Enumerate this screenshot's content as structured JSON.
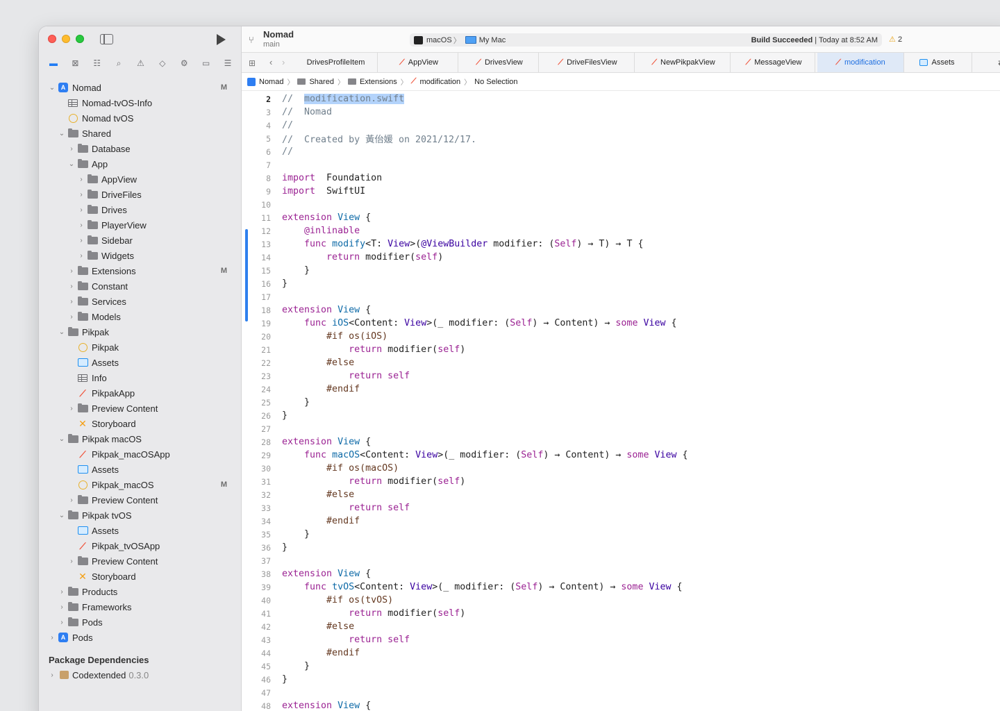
{
  "toolbar": {
    "project": "Nomad",
    "branch": "main",
    "scheme_platform": "macOS",
    "scheme_device": "My Mac",
    "build_status_bold": "Build Succeeded",
    "build_status_time": "| Today at 8:52 AM",
    "warning_count": "2"
  },
  "tabs": [
    {
      "label": "DrivesProfileItem",
      "type": "plain"
    },
    {
      "label": "AppView",
      "type": "swift"
    },
    {
      "label": "DrivesView",
      "type": "swift"
    },
    {
      "label": "DriveFilesView",
      "type": "swift"
    },
    {
      "label": "NewPikpakView",
      "type": "swift"
    },
    {
      "label": "MessageView",
      "type": "swift"
    },
    {
      "label": "modification",
      "type": "swift",
      "active": true
    },
    {
      "label": "Assets",
      "type": "assets"
    }
  ],
  "jumpbar": [
    "Nomad",
    "Shared",
    "Extensions",
    "modification",
    "No Selection"
  ],
  "tree": [
    {
      "label": "Nomad",
      "icon": "project",
      "depth": 0,
      "chev": "down",
      "badge": "M"
    },
    {
      "label": "Nomad-tvOS-Info",
      "icon": "table",
      "depth": 1
    },
    {
      "label": "Nomad tvOS",
      "icon": "target",
      "depth": 1
    },
    {
      "label": "Shared",
      "icon": "folder",
      "depth": 1,
      "chev": "down"
    },
    {
      "label": "Database",
      "icon": "folder",
      "depth": 2,
      "chev": "right"
    },
    {
      "label": "App",
      "icon": "folder",
      "depth": 2,
      "chev": "down"
    },
    {
      "label": "AppView",
      "icon": "folder",
      "depth": 3,
      "chev": "right"
    },
    {
      "label": "DriveFiles",
      "icon": "folder",
      "depth": 3,
      "chev": "right"
    },
    {
      "label": "Drives",
      "icon": "folder",
      "depth": 3,
      "chev": "right"
    },
    {
      "label": "PlayerView",
      "icon": "folder",
      "depth": 3,
      "chev": "right"
    },
    {
      "label": "Sidebar",
      "icon": "folder",
      "depth": 3,
      "chev": "right"
    },
    {
      "label": "Widgets",
      "icon": "folder",
      "depth": 3,
      "chev": "right"
    },
    {
      "label": "Extensions",
      "icon": "folder",
      "depth": 2,
      "chev": "right",
      "badge": "M"
    },
    {
      "label": "Constant",
      "icon": "folder",
      "depth": 2,
      "chev": "right"
    },
    {
      "label": "Services",
      "icon": "folder",
      "depth": 2,
      "chev": "right"
    },
    {
      "label": "Models",
      "icon": "folder",
      "depth": 2,
      "chev": "right"
    },
    {
      "label": "Pikpak",
      "icon": "folder",
      "depth": 1,
      "chev": "down"
    },
    {
      "label": "Pikpak",
      "icon": "target",
      "depth": 2
    },
    {
      "label": "Assets",
      "icon": "assets",
      "depth": 2
    },
    {
      "label": "Info",
      "icon": "table",
      "depth": 2
    },
    {
      "label": "PikpakApp",
      "icon": "swift",
      "depth": 2
    },
    {
      "label": "Preview Content",
      "icon": "folder",
      "depth": 2,
      "chev": "right"
    },
    {
      "label": "Storyboard",
      "icon": "xib",
      "depth": 2
    },
    {
      "label": "Pikpak macOS",
      "icon": "folder",
      "depth": 1,
      "chev": "down"
    },
    {
      "label": "Pikpak_macOSApp",
      "icon": "swift",
      "depth": 2
    },
    {
      "label": "Assets",
      "icon": "assets",
      "depth": 2
    },
    {
      "label": "Pikpak_macOS",
      "icon": "target",
      "depth": 2,
      "badge": "M"
    },
    {
      "label": "Preview Content",
      "icon": "folder",
      "depth": 2,
      "chev": "right"
    },
    {
      "label": "Pikpak tvOS",
      "icon": "folder",
      "depth": 1,
      "chev": "down"
    },
    {
      "label": "Assets",
      "icon": "assets",
      "depth": 2
    },
    {
      "label": "Pikpak_tvOSApp",
      "icon": "swift",
      "depth": 2
    },
    {
      "label": "Preview Content",
      "icon": "folder",
      "depth": 2,
      "chev": "right"
    },
    {
      "label": "Storyboard",
      "icon": "xib",
      "depth": 2
    },
    {
      "label": "Products",
      "icon": "folder",
      "depth": 1,
      "chev": "right"
    },
    {
      "label": "Frameworks",
      "icon": "folder",
      "depth": 1,
      "chev": "right"
    },
    {
      "label": "Pods",
      "icon": "folder",
      "depth": 1,
      "chev": "right"
    },
    {
      "label": "Pods",
      "icon": "project",
      "depth": 0,
      "chev": "right"
    }
  ],
  "package_dependencies": {
    "title": "Package Dependencies",
    "items": [
      {
        "name": "Codextended",
        "version": "0.3.0"
      }
    ]
  },
  "nav_icons": [
    "folder-icon",
    "source-control-icon",
    "symbol-icon",
    "find-icon",
    "issue-icon",
    "test-icon",
    "debug-icon",
    "breakpoint-icon",
    "report-icon"
  ],
  "code": [
    {
      "n": 2,
      "cur": true,
      "tokens": [
        [
          "c",
          "//  "
        ],
        [
          "sel c",
          "modification.swift"
        ]
      ]
    },
    {
      "n": 3,
      "tokens": [
        [
          "c",
          "//  Nomad"
        ]
      ]
    },
    {
      "n": 4,
      "tokens": [
        [
          "c",
          "//"
        ]
      ]
    },
    {
      "n": 5,
      "tokens": [
        [
          "c",
          "//  Created by 黃佁媛 on 2021/12/17."
        ]
      ]
    },
    {
      "n": 6,
      "tokens": [
        [
          "c",
          "//"
        ]
      ]
    },
    {
      "n": 7,
      "tokens": []
    },
    {
      "n": 8,
      "tokens": [
        [
          "k",
          "import"
        ],
        [
          "",
          "  Foundation"
        ]
      ]
    },
    {
      "n": 9,
      "tokens": [
        [
          "k",
          "import"
        ],
        [
          "",
          "  SwiftUI"
        ]
      ]
    },
    {
      "n": 10,
      "tokens": []
    },
    {
      "n": 11,
      "tokens": [
        [
          "k",
          "extension"
        ],
        [
          "",
          " "
        ],
        [
          "n",
          "View"
        ],
        [
          "",
          " {"
        ]
      ]
    },
    {
      "n": 12,
      "tokens": [
        [
          "",
          "    "
        ],
        [
          "k",
          "@inlinable"
        ]
      ]
    },
    {
      "n": 13,
      "tokens": [
        [
          "",
          "    "
        ],
        [
          "k",
          "func"
        ],
        [
          "",
          " "
        ],
        [
          "n",
          "modify"
        ],
        [
          "",
          "<T: "
        ],
        [
          "t",
          "View"
        ],
        [
          "",
          ">("
        ],
        [
          "t",
          "@ViewBuilder"
        ],
        [
          "",
          " modifier: ("
        ],
        [
          "k",
          "Self"
        ],
        [
          "",
          ") → T) → T {"
        ]
      ]
    },
    {
      "n": 14,
      "tokens": [
        [
          "",
          "        "
        ],
        [
          "k",
          "return"
        ],
        [
          "",
          " modifier("
        ],
        [
          "k",
          "self"
        ],
        [
          "",
          ")"
        ]
      ]
    },
    {
      "n": 15,
      "tokens": [
        [
          "",
          "    }"
        ]
      ]
    },
    {
      "n": 16,
      "tokens": [
        [
          "",
          "}"
        ]
      ]
    },
    {
      "n": 17,
      "tokens": []
    },
    {
      "n": 18,
      "tokens": [
        [
          "k",
          "extension"
        ],
        [
          "",
          " "
        ],
        [
          "n",
          "View"
        ],
        [
          "",
          " {"
        ]
      ]
    },
    {
      "n": 19,
      "tokens": [
        [
          "",
          "    "
        ],
        [
          "k",
          "func"
        ],
        [
          "",
          " "
        ],
        [
          "n",
          "iOS"
        ],
        [
          "",
          "<Content: "
        ],
        [
          "t",
          "View"
        ],
        [
          "",
          ">(_ modifier: ("
        ],
        [
          "k",
          "Self"
        ],
        [
          "",
          ") → Content) → "
        ],
        [
          "k",
          "some"
        ],
        [
          "",
          " "
        ],
        [
          "t",
          "View"
        ],
        [
          "",
          " {"
        ]
      ]
    },
    {
      "n": 20,
      "tokens": [
        [
          "",
          "        "
        ],
        [
          "p",
          "#if os(iOS)"
        ]
      ]
    },
    {
      "n": 21,
      "tokens": [
        [
          "",
          "            "
        ],
        [
          "k",
          "return"
        ],
        [
          "",
          " modifier("
        ],
        [
          "k",
          "self"
        ],
        [
          "",
          ")"
        ]
      ]
    },
    {
      "n": 22,
      "tokens": [
        [
          "",
          "        "
        ],
        [
          "p",
          "#else"
        ]
      ]
    },
    {
      "n": 23,
      "tokens": [
        [
          "",
          "            "
        ],
        [
          "k",
          "return"
        ],
        [
          "",
          " "
        ],
        [
          "k",
          "self"
        ]
      ]
    },
    {
      "n": 24,
      "tokens": [
        [
          "",
          "        "
        ],
        [
          "p",
          "#endif"
        ]
      ]
    },
    {
      "n": 25,
      "tokens": [
        [
          "",
          "    }"
        ]
      ]
    },
    {
      "n": 26,
      "tokens": [
        [
          "",
          "}"
        ]
      ]
    },
    {
      "n": 27,
      "tokens": []
    },
    {
      "n": 28,
      "tokens": [
        [
          "k",
          "extension"
        ],
        [
          "",
          " "
        ],
        [
          "n",
          "View"
        ],
        [
          "",
          " {"
        ]
      ]
    },
    {
      "n": 29,
      "tokens": [
        [
          "",
          "    "
        ],
        [
          "k",
          "func"
        ],
        [
          "",
          " "
        ],
        [
          "n",
          "macOS"
        ],
        [
          "",
          "<Content: "
        ],
        [
          "t",
          "View"
        ],
        [
          "",
          ">(_ modifier: ("
        ],
        [
          "k",
          "Self"
        ],
        [
          "",
          ") → Content) → "
        ],
        [
          "k",
          "some"
        ],
        [
          "",
          " "
        ],
        [
          "t",
          "View"
        ],
        [
          "",
          " {"
        ]
      ]
    },
    {
      "n": 30,
      "tokens": [
        [
          "",
          "        "
        ],
        [
          "p",
          "#if os(macOS)"
        ]
      ]
    },
    {
      "n": 31,
      "tokens": [
        [
          "",
          "            "
        ],
        [
          "k",
          "return"
        ],
        [
          "",
          " modifier("
        ],
        [
          "k",
          "self"
        ],
        [
          "",
          ")"
        ]
      ]
    },
    {
      "n": 32,
      "tokens": [
        [
          "",
          "        "
        ],
        [
          "p",
          "#else"
        ]
      ]
    },
    {
      "n": 33,
      "tokens": [
        [
          "",
          "            "
        ],
        [
          "k",
          "return"
        ],
        [
          "",
          " "
        ],
        [
          "k",
          "self"
        ]
      ]
    },
    {
      "n": 34,
      "tokens": [
        [
          "",
          "        "
        ],
        [
          "p",
          "#endif"
        ]
      ]
    },
    {
      "n": 35,
      "tokens": [
        [
          "",
          "    }"
        ]
      ]
    },
    {
      "n": 36,
      "tokens": [
        [
          "",
          "}"
        ]
      ]
    },
    {
      "n": 37,
      "tokens": []
    },
    {
      "n": 38,
      "tokens": [
        [
          "k",
          "extension"
        ],
        [
          "",
          " "
        ],
        [
          "n",
          "View"
        ],
        [
          "",
          " {"
        ]
      ]
    },
    {
      "n": 39,
      "tokens": [
        [
          "",
          "    "
        ],
        [
          "k",
          "func"
        ],
        [
          "",
          " "
        ],
        [
          "n",
          "tvOS"
        ],
        [
          "",
          "<Content: "
        ],
        [
          "t",
          "View"
        ],
        [
          "",
          ">(_ modifier: ("
        ],
        [
          "k",
          "Self"
        ],
        [
          "",
          ") → Content) → "
        ],
        [
          "k",
          "some"
        ],
        [
          "",
          " "
        ],
        [
          "t",
          "View"
        ],
        [
          "",
          " {"
        ]
      ]
    },
    {
      "n": 40,
      "tokens": [
        [
          "",
          "        "
        ],
        [
          "p",
          "#if os(tvOS)"
        ]
      ]
    },
    {
      "n": 41,
      "tokens": [
        [
          "",
          "            "
        ],
        [
          "k",
          "return"
        ],
        [
          "",
          " modifier("
        ],
        [
          "k",
          "self"
        ],
        [
          "",
          ")"
        ]
      ]
    },
    {
      "n": 42,
      "tokens": [
        [
          "",
          "        "
        ],
        [
          "p",
          "#else"
        ]
      ]
    },
    {
      "n": 43,
      "tokens": [
        [
          "",
          "            "
        ],
        [
          "k",
          "return"
        ],
        [
          "",
          " "
        ],
        [
          "k",
          "self"
        ]
      ]
    },
    {
      "n": 44,
      "tokens": [
        [
          "",
          "        "
        ],
        [
          "p",
          "#endif"
        ]
      ]
    },
    {
      "n": 45,
      "tokens": [
        [
          "",
          "    }"
        ]
      ]
    },
    {
      "n": 46,
      "tokens": [
        [
          "",
          "}"
        ]
      ]
    },
    {
      "n": 47,
      "tokens": []
    },
    {
      "n": 48,
      "tokens": [
        [
          "k",
          "extension"
        ],
        [
          "",
          " "
        ],
        [
          "n",
          "View"
        ],
        [
          "",
          " {"
        ]
      ]
    }
  ]
}
